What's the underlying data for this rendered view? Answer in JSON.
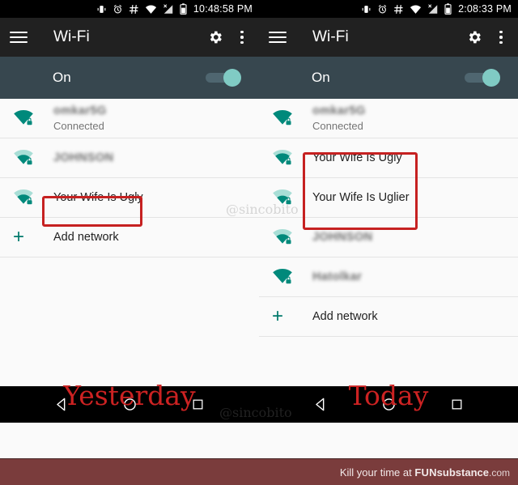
{
  "meta": {
    "caption_left": "Yesterday",
    "caption_right": "Today",
    "watermark": "@sincobito"
  },
  "colors": {
    "teal": "#00897b",
    "teal_dark": "#00796b",
    "toolbar": "#212121",
    "onbar": "#37474f",
    "toggle_thumb": "#80cbc4",
    "highlight_red": "#c62121",
    "caption_red": "#cc2222",
    "footer_bg": "#7a3c3c"
  },
  "panes": [
    {
      "id": "yesterday",
      "statusbar": {
        "time": "10:48:58 PM",
        "icons": [
          "vibrate-icon",
          "alarm-icon",
          "hash-icon",
          "wifi-icon",
          "signal-off-icon",
          "battery-icon"
        ]
      },
      "toolbar": {
        "title": "Wi-Fi",
        "menu_icon": "hamburger-menu-icon",
        "settings_icon": "gear-icon",
        "overflow_icon": "overflow-menu-icon"
      },
      "toggle": {
        "label": "On",
        "state": "on"
      },
      "networks": [
        {
          "ssid": "omkar5G",
          "blurred": true,
          "status": "Connected",
          "signal": 4,
          "secured": true,
          "highlighted": false
        },
        {
          "ssid": "JOHNSON",
          "blurred": true,
          "status": "",
          "signal": 2,
          "secured": true,
          "highlighted": false
        },
        {
          "ssid": "Your Wife Is Ugly",
          "blurred": false,
          "status": "",
          "signal": 2,
          "secured": true,
          "highlighted": true
        }
      ],
      "add_network": {
        "label": "Add network",
        "icon": "plus-icon"
      },
      "navbar": {
        "back": "back-triangle-icon",
        "home": "home-circle-icon",
        "recents": "recents-square-icon"
      }
    },
    {
      "id": "today",
      "statusbar": {
        "time": "2:08:33 PM",
        "icons": [
          "vibrate-icon",
          "alarm-icon",
          "hash-icon",
          "wifi-icon",
          "signal-off-icon",
          "battery-icon"
        ]
      },
      "toolbar": {
        "title": "Wi-Fi",
        "menu_icon": "hamburger-menu-icon",
        "settings_icon": "gear-icon",
        "overflow_icon": "overflow-menu-icon"
      },
      "toggle": {
        "label": "On",
        "state": "on"
      },
      "networks": [
        {
          "ssid": "omkar5G",
          "blurred": true,
          "status": "Connected",
          "signal": 4,
          "secured": true,
          "highlighted": false
        },
        {
          "ssid": "Your Wife Is Ugly",
          "blurred": false,
          "status": "",
          "signal": 3,
          "secured": true,
          "highlighted": true
        },
        {
          "ssid": "Your Wife Is Uglier",
          "blurred": false,
          "status": "",
          "signal": 2,
          "secured": true,
          "highlighted": true
        },
        {
          "ssid": "JOHNSON",
          "blurred": true,
          "status": "",
          "signal": 2,
          "secured": true,
          "highlighted": false
        },
        {
          "ssid": "Hatolkar",
          "blurred": true,
          "status": "",
          "signal": 4,
          "secured": true,
          "highlighted": false
        }
      ],
      "add_network": {
        "label": "Add network",
        "icon": "plus-icon"
      },
      "navbar": {
        "back": "back-triangle-icon",
        "home": "home-circle-icon",
        "recents": "recents-square-icon"
      }
    }
  ],
  "footer": {
    "prefix": "Kill your time at ",
    "brand_a": "FUN",
    "brand_b": "substance",
    "brand_c": ".com"
  }
}
